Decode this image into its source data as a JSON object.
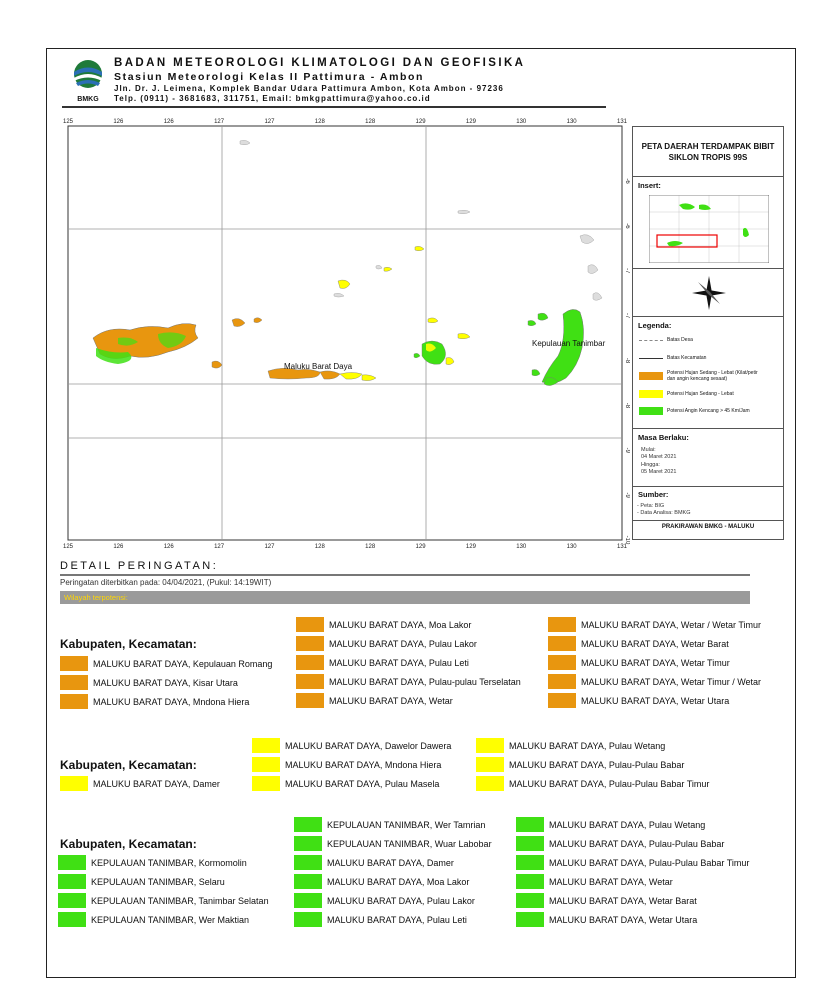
{
  "header": {
    "org": "BADAN METEOROLOGI KLIMATOLOGI DAN GEOFISIKA",
    "station": "Stasiun Meteorologi Kelas II Pattimura - Ambon",
    "address": "Jln. Dr. J. Leimena, Komplek Bandar Udara Pattimura Ambon, Kota Ambon - 97236",
    "contact": "Telp. (0911) - 3681683, 311751, Email: bmkgpattimura@yahoo.co.id",
    "logo_text": "BMKG"
  },
  "map": {
    "lon_ticks_top": [
      "125",
      "126",
      "126",
      "127",
      "127",
      "128",
      "128",
      "129",
      "129",
      "130",
      "130",
      "131"
    ],
    "lon_ticks_bottom": [
      "125",
      "126",
      "126",
      "127",
      "127",
      "128",
      "128",
      "129",
      "129",
      "130",
      "130",
      "131"
    ],
    "lat_ticks_right": [
      "-6",
      "-6",
      "-7",
      "-7",
      "-8",
      "-8",
      "-9",
      "-9",
      "-10"
    ],
    "labels": {
      "maluku_barat_daya": "Maluku Barat Daya",
      "kepulauan_tanimbar": "Kepulauan Tanimbar"
    }
  },
  "panel": {
    "title": "PETA DAERAH TERDAMPAK BIBIT SIKLON TROPIS 99S",
    "insert_label": "Insert:",
    "legend_label": "Legenda:",
    "legend": [
      {
        "kind": "dashed",
        "text": "Batas Desa"
      },
      {
        "kind": "line",
        "text": "Batas Kecamatan"
      },
      {
        "kind": "swatch",
        "color": "#e8960f",
        "text": "Potensi Hujan Sedang - Lebat (Kilat/petir dan angin kencang sesaat)"
      },
      {
        "kind": "swatch",
        "color": "#ffff00",
        "text": "Potensi Hujan Sedang - Lebat"
      },
      {
        "kind": "swatch",
        "color": "#40e014",
        "text": "Potensi Angin Kencang > 45 Km/Jam"
      }
    ],
    "masa_label": "Masa Berlaku:",
    "mulai": "Mulai:",
    "mulai_date": "04 Maret 2021",
    "hingga": "Hingga:",
    "hingga_date": "05 Maret 2021",
    "sumber_label": "Sumber:",
    "sumber_peta": "- Peta: BIG",
    "sumber_data": "- Data Analisa: BMKG",
    "footer": "PRAKIRAWAN BMKG - MALUKU"
  },
  "detail": {
    "title": "DETAIL PERINGATAN:",
    "issued": "Peringatan diterbitkan pada: 04/04/2021, (Pukul: 14:19WIT)",
    "bar": "Wilayah terpotensi:",
    "kec_heading": "Kabupaten, Kecamatan:"
  },
  "orange_items": {
    "col1": [
      "MALUKU BARAT DAYA, Kepulauan Romang",
      "MALUKU BARAT DAYA, Kisar Utara",
      "MALUKU BARAT DAYA, Mndona Hiera"
    ],
    "col2": [
      "MALUKU BARAT DAYA, Moa Lakor",
      "MALUKU BARAT DAYA, Pulau Lakor",
      "MALUKU BARAT DAYA, Pulau Leti",
      "MALUKU BARAT DAYA, Pulau-pulau Terselatan",
      "MALUKU BARAT DAYA, Wetar"
    ],
    "col3": [
      "MALUKU BARAT DAYA, Wetar / Wetar Timur",
      "MALUKU BARAT DAYA, Wetar Barat",
      "MALUKU BARAT DAYA, Wetar Timur",
      "MALUKU BARAT DAYA, Wetar Timur / Wetar",
      "MALUKU BARAT DAYA, Wetar Utara"
    ]
  },
  "yellow_items": {
    "col1": [
      "MALUKU BARAT DAYA, Damer"
    ],
    "col2": [
      "MALUKU BARAT DAYA, Dawelor Dawera",
      "MALUKU BARAT DAYA, Mndona Hiera",
      "MALUKU BARAT DAYA, Pulau Masela"
    ],
    "col3": [
      "MALUKU BARAT DAYA, Pulau Wetang",
      "MALUKU BARAT DAYA, Pulau-Pulau Babar",
      "MALUKU BARAT DAYA, Pulau-Pulau Babar Timur"
    ]
  },
  "green_items": {
    "col1": [
      "KEPULAUAN TANIMBAR, Kormomolin",
      "KEPULAUAN TANIMBAR, Selaru",
      "KEPULAUAN TANIMBAR, Tanimbar Selatan",
      "KEPULAUAN TANIMBAR, Wer Maktian"
    ],
    "col2": [
      "KEPULAUAN TANIMBAR, Wer Tamrian",
      "KEPULAUAN TANIMBAR, Wuar Labobar",
      "MALUKU BARAT DAYA, Damer",
      "MALUKU BARAT DAYA, Moa Lakor",
      "MALUKU BARAT DAYA, Pulau Lakor",
      "MALUKU BARAT DAYA, Pulau Leti"
    ],
    "col3": [
      "MALUKU BARAT DAYA, Pulau Wetang",
      "MALUKU BARAT DAYA, Pulau-Pulau Babar",
      "MALUKU BARAT DAYA, Pulau-Pulau Babar Timur",
      "MALUKU BARAT DAYA, Wetar",
      "MALUKU BARAT DAYA, Wetar Barat",
      "MALUKU BARAT DAYA, Wetar Utara"
    ]
  },
  "colors": {
    "orange": "#e8960f",
    "yellow": "#ffff00",
    "green": "#40e014",
    "bar": "#9a9a9a",
    "bar_text": "#ffd700"
  }
}
